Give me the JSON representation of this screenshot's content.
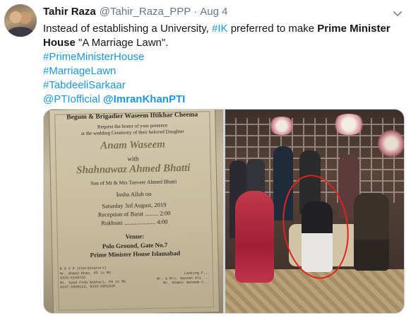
{
  "tweet": {
    "author_name": "Tahir Raza",
    "handle": "@Tahir_Raza_PPP",
    "separator": "·",
    "date": "Aug 4",
    "text": {
      "line1_pre": "Instead of establishing a University, ",
      "line1_tag": "#IK",
      "line1_mid": " preferred to make ",
      "line1_bold": "Prime Minister",
      "line2_bold": "House",
      "line2_rest": " \"A Marriage Lawn\".",
      "hashtag1": "#PrimeMinisterHouse",
      "hashtag2": "#MarriageLawn",
      "hashtag3": "#TabdeeliSarkaar",
      "mention1": "@PTIofficial",
      "mention2": "@ImranKhanPTI"
    },
    "link_color": "#1b95e0"
  },
  "invitation": {
    "title": "Begum & Brigadier Waseem Iftikhar Cheema",
    "request_line1": "Request the honor of your presence",
    "request_line2": "at the wedding Ceremony of their beloved Daughter",
    "bride": "Anam Waseem",
    "with": "with",
    "groom": "Shahnawaz Ahmed Bhatti",
    "groom_parents": "Son of Mr & Mrs Tanveer Ahmed Bhatti",
    "insha": "Insha Allah on",
    "date_line": "Saturday 3rd August, 2019",
    "reception": "Reception of Barat ......... 2:00",
    "rukhsati": "Rukhsati ..................... 4:00",
    "venue_title": "Venue:",
    "venue_line1": "Polo Ground, Gate No.7",
    "venue_line2": "Prime Minister House Islamabad",
    "rsvp_left": "R S V P (Coordinators)\nMr. Ahmad Khan, PS to MS\n0333-5150742\nMr. Syed Fida Bukhari, PA to MS\n0347-5968113, 0333-5951020",
    "rsvp_right": "Looking F...\nMr. & Mrs. Hassan Ali ...\nMr. Shamir Waseem C..."
  }
}
